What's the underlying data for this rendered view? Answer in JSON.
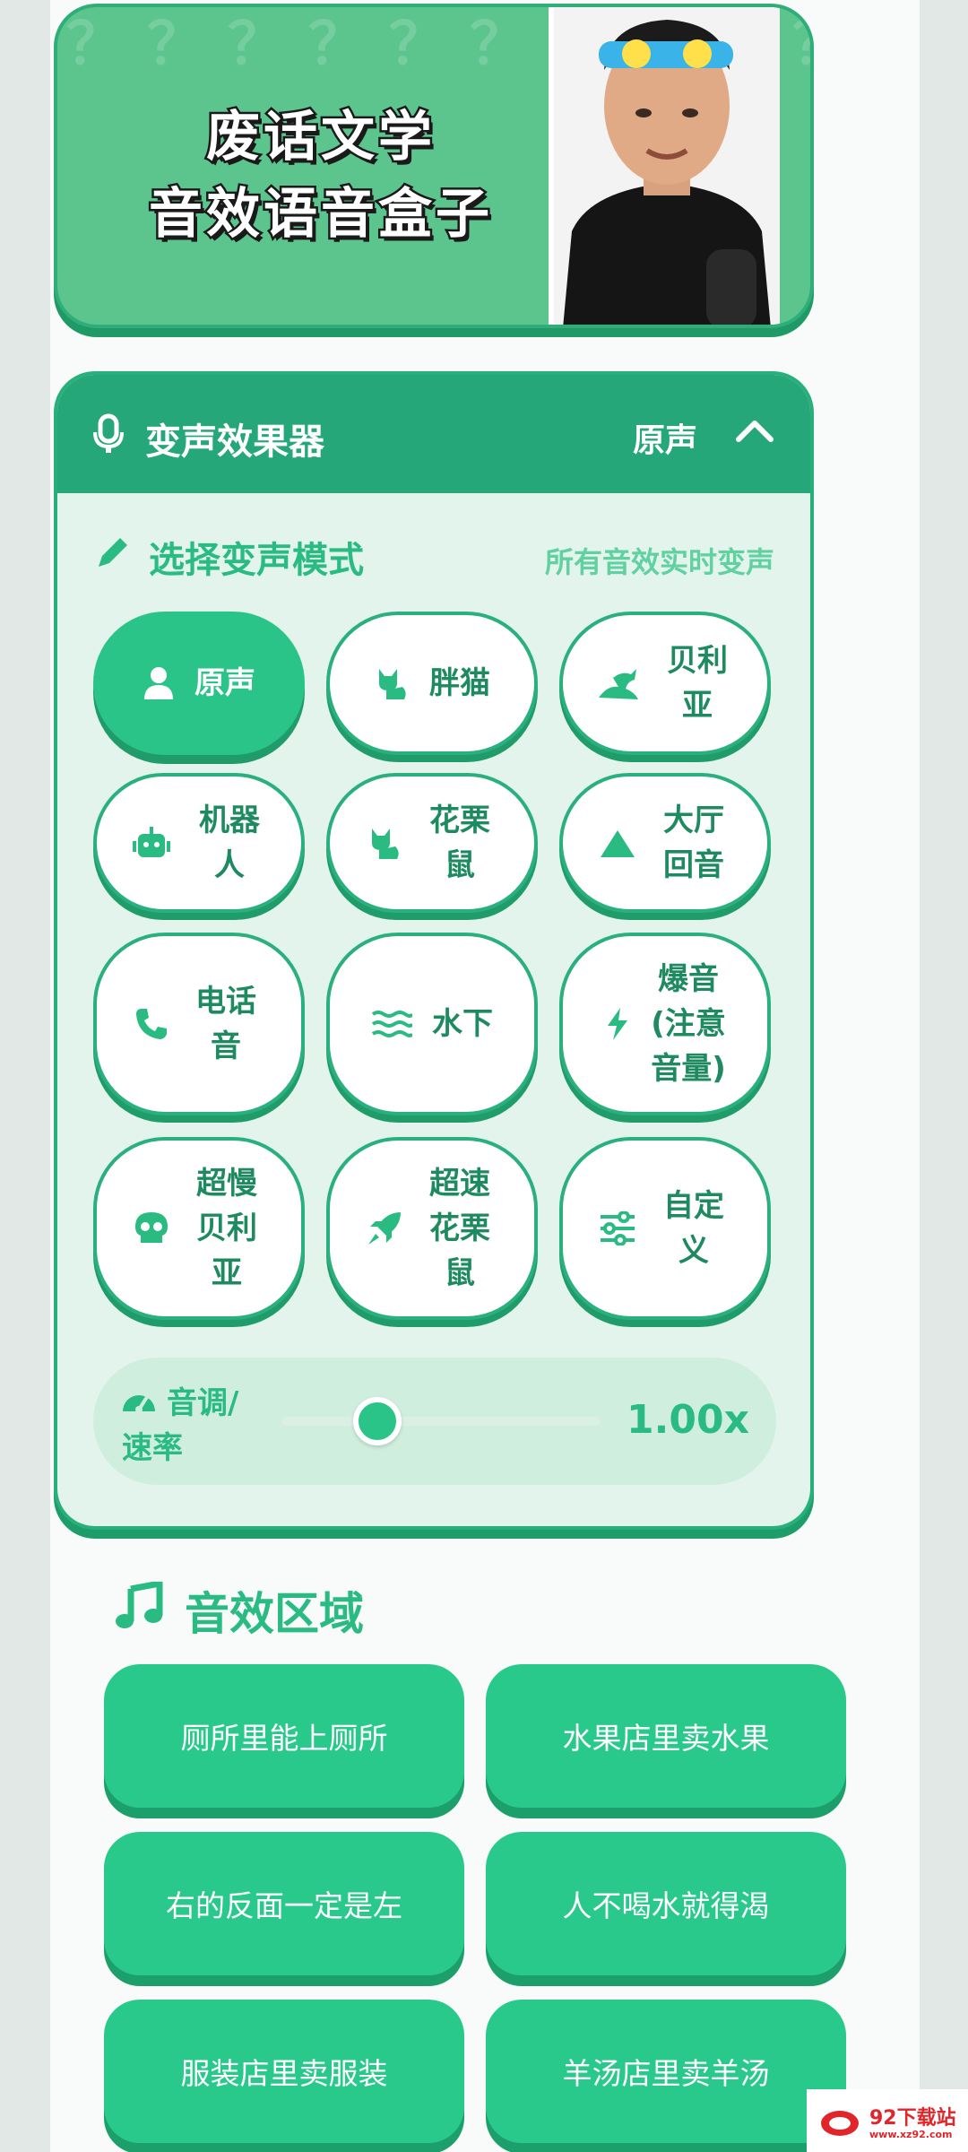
{
  "banner": {
    "title_line1": "废话文学",
    "title_line2": "音效语音盒子",
    "bg_pattern": "？？？？？？？？？？？？？？？？？？？？？？？？？？？？？？？？？？？？？？？？？？？？？？？？？？？？"
  },
  "changer": {
    "title": "变声效果器",
    "current": "原声",
    "section_title": "选择变声模式",
    "section_note": "所有音效实时变声",
    "modes": [
      {
        "label": "原声",
        "icon": "user-icon",
        "active": true
      },
      {
        "label": "胖猫",
        "icon": "cat-icon"
      },
      {
        "label": "贝利亚",
        "icon": "dragon-icon"
      },
      {
        "label": "机器人",
        "icon": "robot-icon"
      },
      {
        "label": "花栗鼠",
        "icon": "cat-icon"
      },
      {
        "label": "大厅回音",
        "icon": "mountain-icon"
      },
      {
        "label": "电话音",
        "icon": "phone-icon"
      },
      {
        "label": "水下",
        "icon": "water-icon"
      },
      {
        "label": "爆音(注意音量)",
        "icon": "bolt-icon"
      },
      {
        "label": "超慢贝利亚",
        "icon": "skull-icon"
      },
      {
        "label": "超速花栗鼠",
        "icon": "rocket-icon"
      },
      {
        "label": "自定义",
        "icon": "sliders-icon"
      }
    ],
    "pitch": {
      "label": "音调/速率",
      "value": "1.00x",
      "fraction": 0.3
    }
  },
  "sfx": {
    "title": "音效区域",
    "buttons": [
      "厕所里能上厕所",
      "水果店里卖水果",
      "右的反面一定是左",
      "人不喝水就得渴",
      "服装店里卖服装",
      "羊汤店里卖羊汤"
    ]
  },
  "watermark": {
    "name": "92下载站",
    "url": "www.xz92.com"
  },
  "colors": {
    "primary": "#2bc488",
    "dark": "#26a77a",
    "text": "#1e8a5f"
  }
}
